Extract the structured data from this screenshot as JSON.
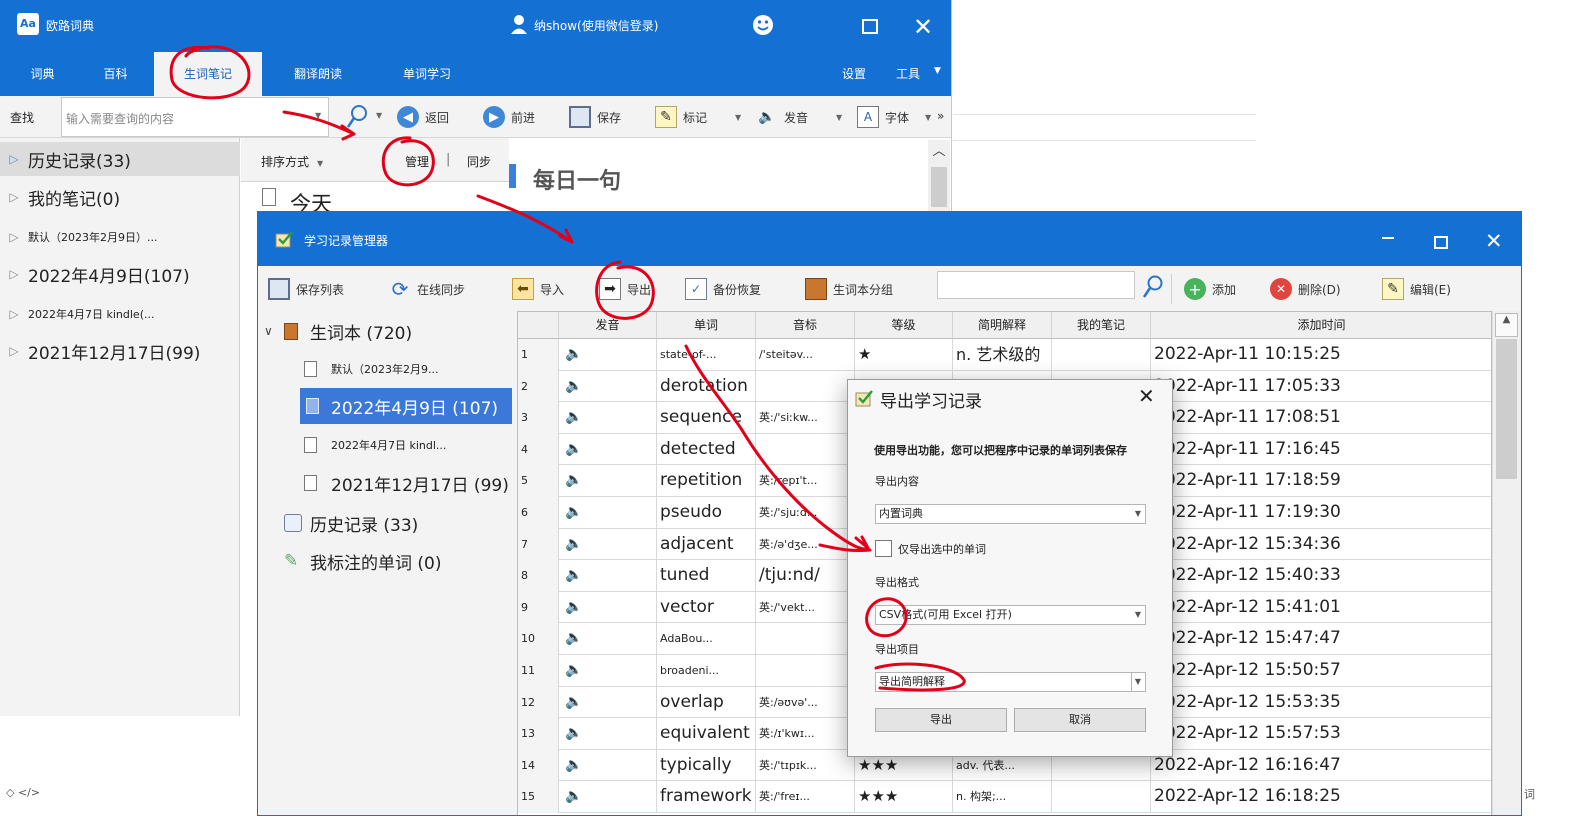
{
  "main_window": {
    "title": "欧路词典",
    "user": "纳show(使用微信登录)",
    "tabs": [
      "词典",
      "百科",
      "生词笔记",
      "翻译朗读",
      "单词学习"
    ],
    "right_menu": [
      "设置",
      "工具"
    ],
    "search_label": "查找",
    "search_placeholder": "输入需要查询的内容",
    "toolbar": [
      "返回",
      "前进",
      "保存",
      "标记",
      "发音",
      "字体"
    ],
    "sidebar": [
      "历史记录(33)",
      "我的笔记(0)",
      "默认（2023年2月9日）...",
      "2022年4月9日(107)",
      "2022年4月7日 kindle(...",
      "2021年12月17日(99)"
    ],
    "sort_label": "排序方式",
    "manage_label": "管理",
    "sync_label": "同步",
    "today_label": "今天",
    "daily_label": "每日一句"
  },
  "manager": {
    "title": "学习记录管理器",
    "toolbar": [
      "保存列表",
      "在线同步",
      "导入",
      "导出",
      "备份恢复",
      "生词本分组",
      "添加",
      "删除(D)",
      "编辑(E)"
    ],
    "tree": {
      "root": "生词本 (720)",
      "children": [
        "默认（2023年2月9...",
        "2022年4月9日 (107)",
        "2022年4月7日 kindl...",
        "2021年12月17日 (99)"
      ],
      "history": "历史记录 (33)",
      "marked": "我标注的单词 (0)"
    },
    "columns": [
      "发音",
      "单词",
      "音标",
      "等级",
      "简明解释",
      "我的笔记",
      "添加时间"
    ],
    "rows": [
      {
        "n": "1",
        "word": "state-of-...",
        "phon": "/'steitəv...",
        "level": "★",
        "def": "n. 艺术级的",
        "time": "2022-Apr-11 10:15:25",
        "small": true
      },
      {
        "n": "2",
        "word": "derotation",
        "phon": "",
        "level": "",
        "def": "",
        "time": "2022-Apr-11 17:05:33"
      },
      {
        "n": "3",
        "word": "sequence",
        "phon": "英:/'siːkw...",
        "level": "",
        "def": "",
        "time": "2022-Apr-11 17:08:51"
      },
      {
        "n": "4",
        "word": "detected",
        "phon": "",
        "level": "",
        "def": "",
        "time": "2022-Apr-11 17:16:45"
      },
      {
        "n": "5",
        "word": "repetition",
        "phon": "英:/repɪ't...",
        "level": "",
        "def": "",
        "time": "2022-Apr-11 17:18:59"
      },
      {
        "n": "6",
        "word": "pseudo",
        "phon": "英:/'sjuːd...",
        "level": "",
        "def": "",
        "time": "2022-Apr-11 17:19:30"
      },
      {
        "n": "7",
        "word": "adjacent",
        "phon": "英:/ə'dʒe...",
        "level": "",
        "def": "",
        "time": "2022-Apr-12 15:34:36"
      },
      {
        "n": "8",
        "word": "tuned",
        "phon": "/tju:nd/",
        "level": "",
        "def": "",
        "time": "2022-Apr-12 15:40:33",
        "bigphon": true
      },
      {
        "n": "9",
        "word": "vector",
        "phon": "英:/'vekt...",
        "level": "",
        "def": "",
        "time": "2022-Apr-12 15:41:01"
      },
      {
        "n": "10",
        "word": "AdaBou...",
        "phon": "",
        "level": "",
        "def": "",
        "time": "2022-Apr-12 15:47:47",
        "small": true
      },
      {
        "n": "11",
        "word": "broadeni...",
        "phon": "",
        "level": "",
        "def": "",
        "time": "2022-Apr-12 15:50:57",
        "small": true
      },
      {
        "n": "12",
        "word": "overlap",
        "phon": "英:/əʊvə'...",
        "level": "",
        "def": "",
        "time": "2022-Apr-12 15:53:35"
      },
      {
        "n": "13",
        "word": "equivalent",
        "phon": "英:/ɪ'kwɪ...",
        "level": "",
        "def": "",
        "time": "2022-Apr-12 15:57:53"
      },
      {
        "n": "14",
        "word": "typically",
        "phon": "英:/'tɪpɪk...",
        "level": "★★★",
        "def": "adv. 代表...",
        "time": "2022-Apr-12 16:16:47"
      },
      {
        "n": "15",
        "word": "framework",
        "phon": "英:/'freɪ...",
        "level": "★★★",
        "def": "n. 构架;...",
        "time": "2022-Apr-12 16:18:25"
      }
    ]
  },
  "dialog": {
    "title": "导出学习记录",
    "desc": "使用导出功能，您可以把程序中记录的单词列表保存",
    "content_label": "导出内容",
    "content_value": "内置词典",
    "only_selected": "仅导出选中的单词",
    "format_label": "导出格式",
    "format_value": "CSV格式(可用 Excel 打开)",
    "items_label": "导出项目",
    "items_value": "导出简明解释",
    "export_btn": "导出",
    "cancel_btn": "取消"
  },
  "footer_glyph": "词",
  "colors": {
    "title_blue": "#1570d4",
    "selection": "#3c78d8",
    "annotation": "#e0001a"
  }
}
